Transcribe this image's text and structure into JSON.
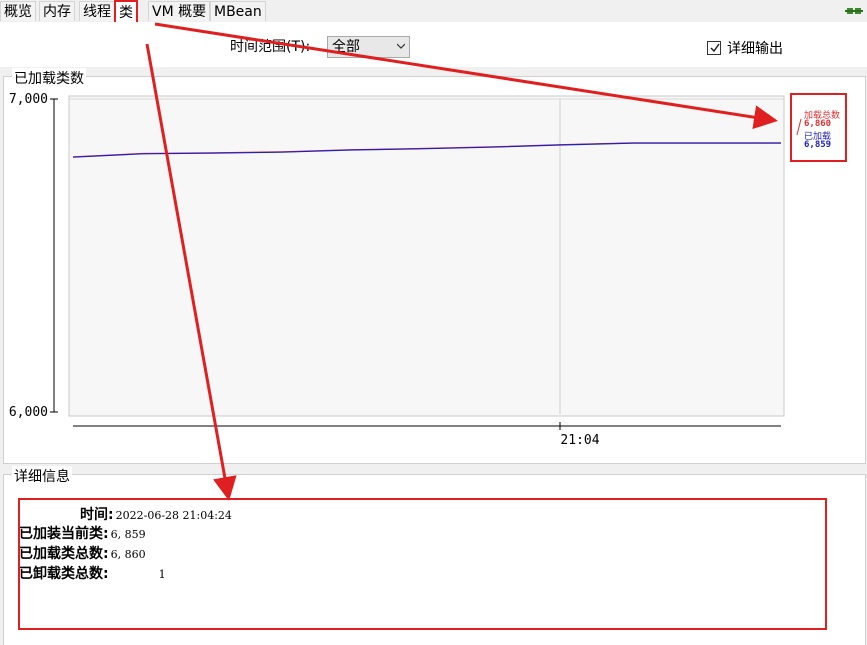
{
  "tabs": [
    {
      "label": "概览"
    },
    {
      "label": "内存"
    },
    {
      "label": "线程"
    },
    {
      "label": "类"
    },
    {
      "label": "VM 概要"
    },
    {
      "label": "MBean"
    }
  ],
  "toolbar": {
    "range_label": "时间范围(T):",
    "range_value": "全部",
    "detail_output_label": "详细输出",
    "detail_output_checked": true
  },
  "chart_section": {
    "title": "已加载类数"
  },
  "chart_data": {
    "type": "line",
    "yticks": [
      "7,000",
      "6,000"
    ],
    "ylim": [
      6000,
      7000
    ],
    "xticks": [
      "21:04"
    ],
    "series": [
      {
        "name": "加载总数",
        "color": "#e03030",
        "current": "6,860",
        "values": [
          6815,
          6826,
          6828,
          6831,
          6838,
          6842,
          6847,
          6854,
          6860,
          6860,
          6860
        ]
      },
      {
        "name": "已加载",
        "color": "#2020c0",
        "current": "6,859",
        "values": [
          6814,
          6825,
          6827,
          6830,
          6837,
          6841,
          6846,
          6853,
          6859,
          6859,
          6859
        ]
      }
    ]
  },
  "details": {
    "title": "详细信息",
    "rows": [
      {
        "label": "时间:",
        "value": "2022-06-28 21:04:24"
      },
      {
        "label": "已加装当前类:",
        "value": "6, 859"
      },
      {
        "label": "已加载类总数:",
        "value": "6, 860"
      },
      {
        "label": "已卸载类总数:",
        "value": "1"
      }
    ]
  },
  "colors": {
    "annotation": "#e02020",
    "plot_bg": "#f7f7f7"
  }
}
